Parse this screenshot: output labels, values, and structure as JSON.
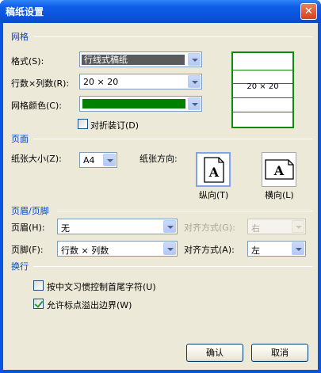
{
  "window": {
    "title": "稿纸设置",
    "close_glyph": "✕"
  },
  "grid": {
    "section": "网格",
    "format_label": "格式(S):",
    "format_value": "行线式稿纸",
    "rowcol_label": "行数×列数(R):",
    "rowcol_value": "20 × 20",
    "color_label": "网格颜色(C):",
    "color_value": "#008000",
    "fold_label": "对折装订(D)",
    "fold_checked": false,
    "preview_text": "20 × 20"
  },
  "page": {
    "section": "页面",
    "size_label": "纸张大小(Z):",
    "size_value": "A4",
    "orient_label": "纸张方向:",
    "portrait_label": "纵向(T)",
    "landscape_label": "横向(L)",
    "orient_glyph": "A",
    "selected": "portrait"
  },
  "hf": {
    "section": "页眉/页脚",
    "header_label": "页眉(H):",
    "header_value": "无",
    "header_align_label": "对齐方式(G):",
    "header_align_value": "右",
    "footer_label": "页脚(F):",
    "footer_value": "行数 × 列数",
    "footer_align_label": "对齐方式(A):",
    "footer_align_value": "左"
  },
  "wrap": {
    "section": "换行",
    "opt1_label": "按中文习惯控制首尾字符(U)",
    "opt1_checked": false,
    "opt2_label": "允许标点溢出边界(W)",
    "opt2_checked": true
  },
  "buttons": {
    "ok": "确认",
    "cancel": "取消"
  },
  "colors": {
    "titlebar": "#0a53db",
    "accent_blue": "#0046d5",
    "grid_green": "#008000"
  }
}
